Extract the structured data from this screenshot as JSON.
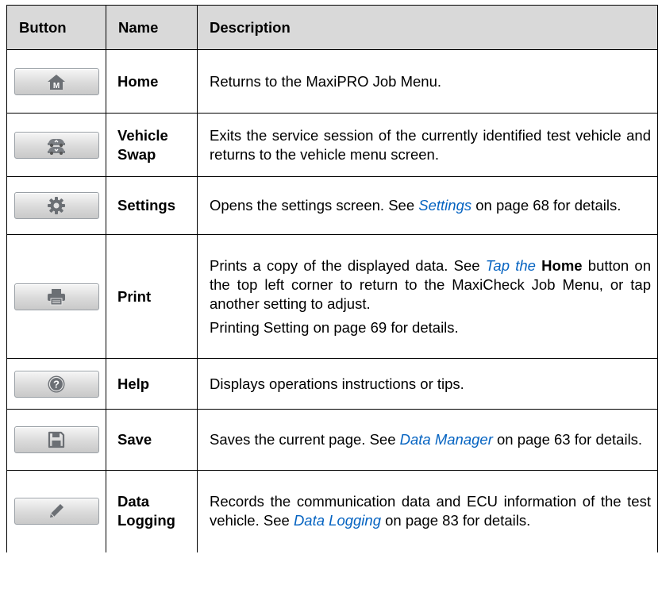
{
  "table": {
    "headers": [
      "Button",
      "Name",
      "Description"
    ],
    "rows": [
      {
        "icon": "home-icon",
        "name": "Home",
        "desc": "Returns to the MaxiPRO Job Menu."
      },
      {
        "icon": "vehicle-swap-icon",
        "name": "Vehicle Swap",
        "desc": "Exits the service session of the currently identified test vehicle and returns to the vehicle menu screen."
      },
      {
        "icon": "gear-icon",
        "name": "Settings",
        "desc_pre": "Opens the settings screen. See ",
        "desc_link": "Settings",
        "desc_post": " on page 68 for details."
      },
      {
        "icon": "printer-icon",
        "name": "Print",
        "desc_pre": "Prints a copy of the displayed data. See ",
        "desc_link": "Tap the",
        "desc_bold": "Home",
        "desc_post": " button on the top left corner to return to the MaxiCheck Job Menu, or tap another setting to adjust.",
        "desc2": "Printing Setting on page 69 for details."
      },
      {
        "icon": "help-icon",
        "name": "Help",
        "desc": "Displays operations instructions or tips."
      },
      {
        "icon": "save-icon",
        "name": "Save",
        "desc_pre": "Saves the current page. See ",
        "desc_link": "Data Manager",
        "desc_post": " on page 63 for details."
      },
      {
        "icon": "pencil-icon",
        "name": "Data Logging",
        "desc_pre": "Records the communication data and ECU information of the test vehicle. See ",
        "desc_link": "Data Logging",
        "desc_post": " on page 83 for details."
      }
    ]
  }
}
